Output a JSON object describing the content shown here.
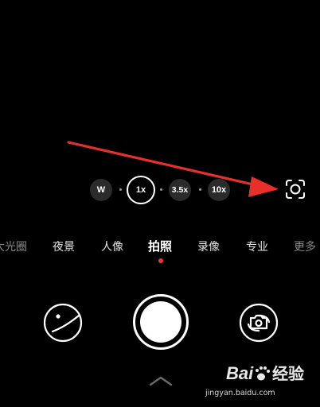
{
  "zoom": {
    "options": [
      "W",
      "1x",
      "3.5x",
      "10x"
    ],
    "selected": "1x"
  },
  "modes": {
    "items": [
      "大光圈",
      "夜景",
      "人像",
      "拍照",
      "录像",
      "专业",
      "更多"
    ],
    "selected": "拍照"
  },
  "colors": {
    "annotation_arrow": "#e8302a",
    "mode_indicator": "#e53935",
    "background": "#000000"
  },
  "icons": {
    "lens": "focus-lens-icon",
    "gallery": "gallery-thumbnail-icon",
    "flip": "camera-switch-icon",
    "chevron": "chevron-up-icon"
  },
  "watermark": {
    "brand": "Baidu经验",
    "url": "jingyan.baidu.com"
  }
}
